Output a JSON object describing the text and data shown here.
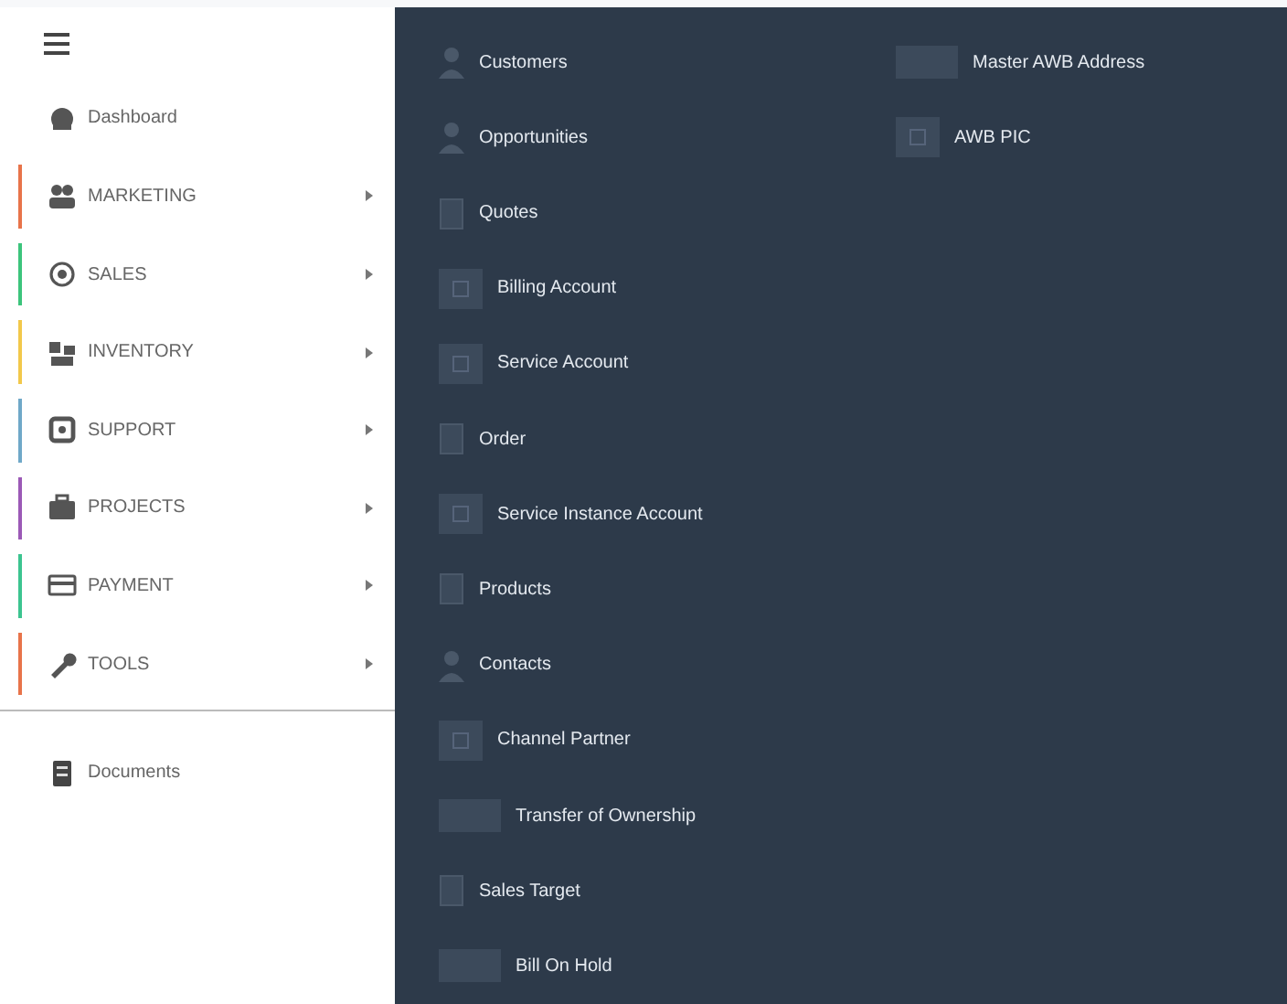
{
  "sidebar": {
    "items": [
      {
        "label": "Dashboard",
        "expandable": false
      },
      {
        "label": "MARKETING",
        "expandable": true,
        "color": "#e8744a"
      },
      {
        "label": "SALES",
        "expandable": true,
        "color": "#3cc47c"
      },
      {
        "label": "INVENTORY",
        "expandable": true,
        "color": "#f2c84b"
      },
      {
        "label": "SUPPORT",
        "expandable": true,
        "color": "#6fa8c8"
      },
      {
        "label": "PROJECTS",
        "expandable": true,
        "color": "#9b59b6"
      },
      {
        "label": "PAYMENT",
        "expandable": true,
        "color": "#3cc490"
      },
      {
        "label": "TOOLS",
        "expandable": true,
        "color": "#e8744a"
      }
    ],
    "footer_items": [
      {
        "label": "Documents"
      }
    ]
  },
  "submenu": {
    "columns": [
      [
        {
          "label": "Customers",
          "kind": "person"
        },
        {
          "label": "Opportunities",
          "kind": "person"
        },
        {
          "label": "Quotes",
          "kind": "small"
        },
        {
          "label": "Billing Account",
          "kind": "box"
        },
        {
          "label": "Service Account",
          "kind": "box"
        },
        {
          "label": "Order",
          "kind": "small"
        },
        {
          "label": "Service Instance Account",
          "kind": "box"
        },
        {
          "label": "Products",
          "kind": "small"
        },
        {
          "label": "Contacts",
          "kind": "person"
        },
        {
          "label": "Channel Partner",
          "kind": "box"
        },
        {
          "label": "Transfer of Ownership",
          "kind": "wide"
        },
        {
          "label": "Sales Target",
          "kind": "small"
        },
        {
          "label": "Bill On Hold",
          "kind": "wide"
        }
      ],
      [
        {
          "label": "Master AWB Address",
          "kind": "wide"
        },
        {
          "label": "AWB PIC",
          "kind": "box"
        }
      ]
    ]
  }
}
